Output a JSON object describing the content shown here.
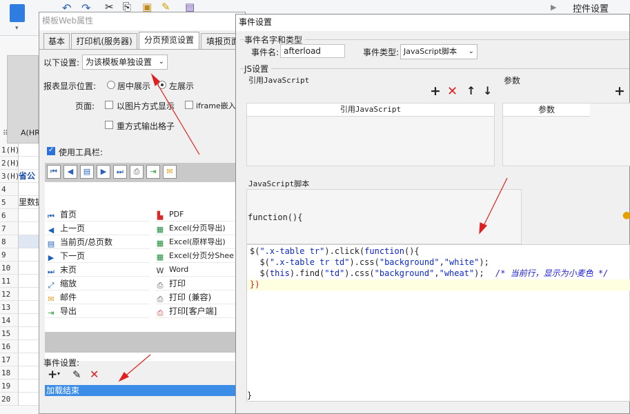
{
  "background": {
    "font_name": "宋体",
    "right_panel_title": "控件设置",
    "column_header": "A(HR",
    "rows": [
      {
        "num": "1(H)",
        "cell": ""
      },
      {
        "num": "2(H)",
        "cell": ""
      },
      {
        "num": "3(H)",
        "cell": "省公"
      },
      {
        "num": "4",
        "cell": ""
      },
      {
        "num": "5",
        "cell": "里数据"
      },
      {
        "num": "6",
        "cell": ""
      },
      {
        "num": "7",
        "cell": ""
      },
      {
        "num": "8",
        "cell": ""
      },
      {
        "num": "9",
        "cell": ""
      },
      {
        "num": "10",
        "cell": ""
      },
      {
        "num": "11",
        "cell": ""
      },
      {
        "num": "12",
        "cell": ""
      },
      {
        "num": "13",
        "cell": ""
      },
      {
        "num": "14",
        "cell": ""
      },
      {
        "num": "15",
        "cell": ""
      },
      {
        "num": "16",
        "cell": ""
      },
      {
        "num": "17",
        "cell": ""
      },
      {
        "num": "18",
        "cell": ""
      },
      {
        "num": "19",
        "cell": ""
      },
      {
        "num": "20",
        "cell": ""
      }
    ]
  },
  "web_dialog": {
    "title": "模板Web属性",
    "tabs": [
      "基本",
      "打印机(服务器)",
      "分页预览设置",
      "填报页面"
    ],
    "settings_label": "以下设置:",
    "settings_value": "为该模板单独设置",
    "position_label": "报表显示位置:",
    "center_label": "居中展示",
    "left_label": "左展示",
    "page_label": "页面:",
    "image_mode_label": "以图片方式显示",
    "iframe_label": "iframe嵌入",
    "redo_grid_label": "重方式输出格子",
    "use_toolbar_label": "使用工具栏:",
    "list_items_left": [
      "首页",
      "上一页",
      "当前页/总页数",
      "下一页",
      "末页",
      "缩放",
      "邮件",
      "导出"
    ],
    "list_items_right": [
      "PDF",
      "Excel(分页导出)",
      "Excel(原样导出)",
      "Excel(分页分Shee",
      "Word",
      "打印",
      "打印 (兼容)",
      "打印[客户端]"
    ],
    "event_settings_label": "事件设置:",
    "event_item": "加载结束"
  },
  "event_dialog": {
    "title": "事件设置",
    "name_type_group": "事件名字和类型",
    "event_name_label": "事件名:",
    "event_name_value": "afterload",
    "event_type_label": "事件类型:",
    "event_type_value": "JavaScript脚本",
    "js_group": "JS设置",
    "ref_js_label": "引用JavaScript",
    "params_label": "参数",
    "ref_js_header": "引用JavaScript",
    "params_header": "参数",
    "script_label": "JavaScript脚本",
    "function_header": "function(){",
    "code_lines": [
      "$(\".x-table tr\").click(function(){",
      "  $(\".x-table tr td\").css(\"background\",\"white\");",
      "  $(this).find(\"td\").css(\"background\",\"wheat\");",
      "})"
    ],
    "code_comment": "/* 当前行，显示为小麦色 */",
    "closing_brace": "}"
  }
}
